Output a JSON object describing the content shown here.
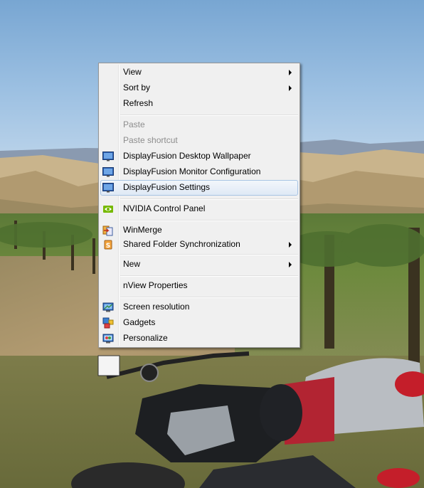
{
  "menu": {
    "view": "View",
    "sort_by": "Sort by",
    "refresh": "Refresh",
    "paste": "Paste",
    "paste_shortcut": "Paste shortcut",
    "df_wallpaper": "DisplayFusion Desktop Wallpaper",
    "df_monitor": "DisplayFusion Monitor Configuration",
    "df_settings": "DisplayFusion Settings",
    "nvidia": "NVIDIA Control Panel",
    "winmerge": "WinMerge",
    "shared_folder": "Shared Folder Synchronization",
    "new": "New",
    "nview": "nView Properties",
    "screen_resolution": "Screen resolution",
    "gadgets": "Gadgets",
    "personalize": "Personalize"
  },
  "colors": {
    "menu_bg": "#f0f0f0",
    "highlight": "#dfe9f5",
    "disabled_text": "#8d8d8d"
  }
}
